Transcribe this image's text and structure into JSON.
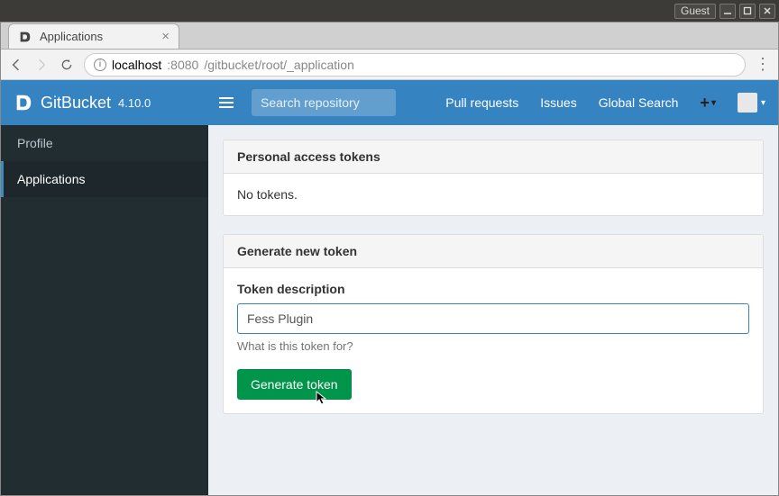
{
  "os": {
    "guest_label": "Guest"
  },
  "browser": {
    "tab_title": "Applications",
    "url_host": "localhost",
    "url_port": ":8080",
    "url_path": "/gitbucket/root/_application"
  },
  "topbar": {
    "brand_name": "GitBucket",
    "brand_version": "4.10.0",
    "search_placeholder": "Search repository",
    "links": {
      "pull_requests": "Pull requests",
      "issues": "Issues",
      "global_search": "Global Search"
    }
  },
  "sidebar": {
    "items": [
      {
        "label": "Profile",
        "active": false
      },
      {
        "label": "Applications",
        "active": true
      }
    ]
  },
  "main": {
    "panel1": {
      "heading": "Personal access tokens",
      "body_text": "No tokens."
    },
    "panel2": {
      "heading": "Generate new token",
      "field_label": "Token description",
      "field_value": "Fess Plugin",
      "help_text": "What is this token for?",
      "button_label": "Generate token"
    }
  }
}
